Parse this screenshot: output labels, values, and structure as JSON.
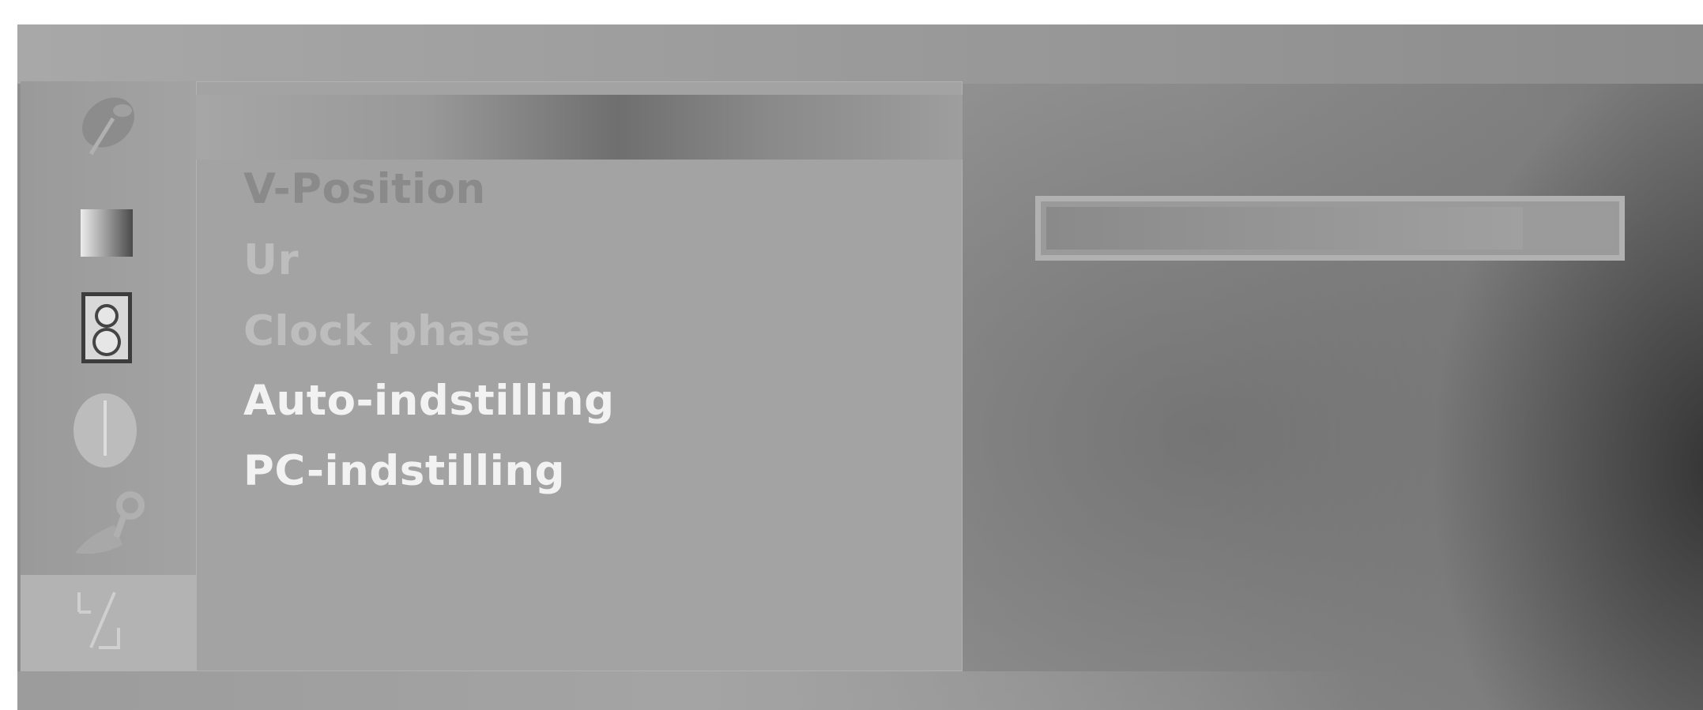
{
  "menu": {
    "items": [
      {
        "label": "V-Position",
        "state": "highlighted"
      },
      {
        "label": "Ur",
        "state": "dim"
      },
      {
        "label": "Clock phase",
        "state": "dim"
      },
      {
        "label": "Auto-indstilling",
        "state": "normal"
      },
      {
        "label": "PC-indstilling",
        "state": "normal"
      }
    ]
  },
  "sidebar": {
    "icons": [
      {
        "name": "satellite-dish-icon"
      },
      {
        "name": "picture-icon"
      },
      {
        "name": "speaker-icon"
      },
      {
        "name": "clock-icon"
      },
      {
        "name": "settings-wrench-icon"
      },
      {
        "name": "screen-adjust-icon",
        "selected": true
      }
    ]
  },
  "value_bar": {
    "level_fraction": 0.84
  },
  "colors": {
    "screen_bg": "#959595",
    "panel_bg": "#a3a3a3",
    "text_bright": "#f2f2f2",
    "text_dim": "#bdbdbd"
  }
}
